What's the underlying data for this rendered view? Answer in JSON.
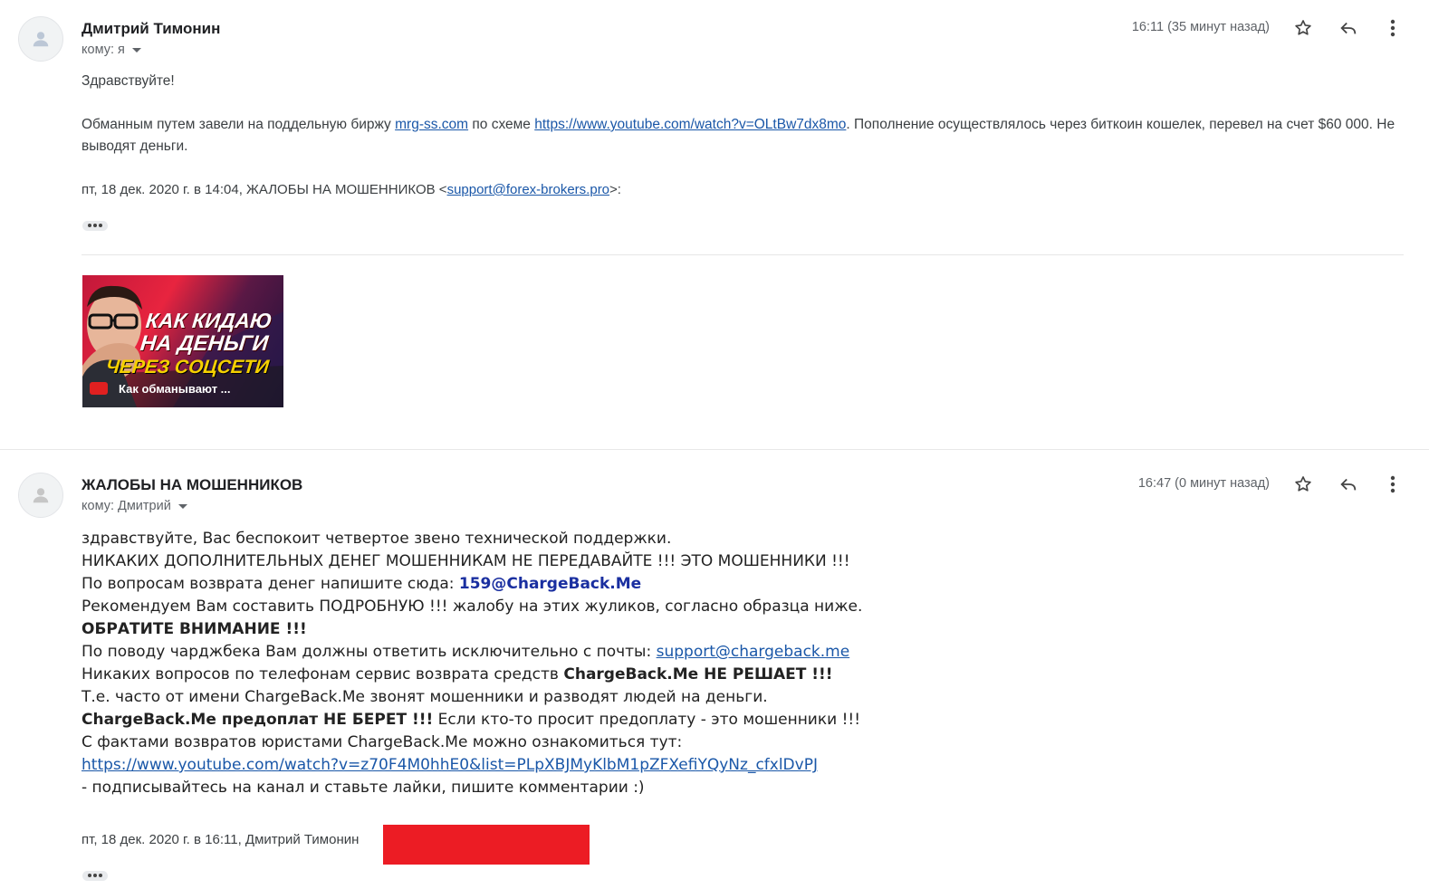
{
  "message1": {
    "sender": "Дмитрий Тимонин",
    "to_label": "кому: я",
    "time": "16:11 (35 минут назад)",
    "greeting": "Здравствуйте!",
    "para_prefix": "Обманным путем завели на поддельную биржу ",
    "link_site": "mrg-ss.com",
    "para_mid": " по схеме ",
    "link_youtube": "https://www.youtube.com/watch?v=OLtBw7dx8mo",
    "para_suffix": ". Пополнение осуществлялось через биткоин кошелек, перевел на счет $60 000. Не выводят деньги.",
    "quote_prefix": "пт, 18 дек. 2020 г. в 14:04, ЖАЛОБЫ НА МОШЕННИКОВ <",
    "quote_email": "support@forex-brokers.pro",
    "quote_suffix": ">:",
    "thumbnail": {
      "line1": "КАК КИДАЮ",
      "line2": "НА ДЕНЬГИ",
      "line3": "ЧЕРЕЗ СОЦСЕТИ",
      "caption": "Как обманывают ..."
    }
  },
  "message2": {
    "sender": "ЖАЛОБЫ НА МОШЕННИКОВ",
    "to_label": "кому: Дмитрий",
    "time": "16:47 (0 минут назад)",
    "line1": "здравствуйте, Вас беспокоит четвертое звено технической поддержки.",
    "line2": "НИКАКИХ ДОПОЛНИТЕЛЬНЫХ ДЕНЕГ МОШЕННИКАМ НЕ ПЕРЕДАВАЙТЕ !!! ЭТО МОШЕННИКИ !!!",
    "line3_prefix": "По вопросам возврата денег напишите сюда: ",
    "line3_email": "159@ChargeBack.Me",
    "line4": "Рекомендуем Вам составить ПОДРОБНУЮ !!! жалобу на этих жуликов, согласно образца ниже.",
    "line5": "ОБРАТИТЕ ВНИМАНИЕ !!!",
    "line6_prefix": "По поводу чарджбека Вам должны ответить исключительно с почты: ",
    "line6_email": "support@chargeback.me",
    "line7_prefix": "Никаких вопросов по телефонам сервис возврата средств ",
    "line7_bold": "ChargeBack.Me НЕ РЕШАЕТ !!!",
    "line8": "Т.е. часто от имени ChargeBack.Me звонят мошенники и разводят людей на деньги.",
    "line9_bold": "ChargeBack.Me предоплат НЕ БЕРЕТ !!!",
    "line9_suffix": " Если кто-то просит предоплату - это мошенники !!!",
    "line10": "С фактами возвратов юристами ChargeBack.Me можно ознакомиться тут:",
    "line11_link": "https://www.youtube.com/watch?v=z70F4M0hhE0&list=PLpXBJMyKlbM1pZFXefiYQyNz_cfxlDvPJ",
    "line12": " - подписывайтесь на канал и ставьте лайки, пишите комментарии :)",
    "quote": "пт, 18 дек. 2020 г. в 16:11, Дмитрий Тимонин"
  },
  "colors": {
    "link": "#1a57a8",
    "link_bold": "#1a2fa0",
    "redaction": "#ec1c24"
  }
}
